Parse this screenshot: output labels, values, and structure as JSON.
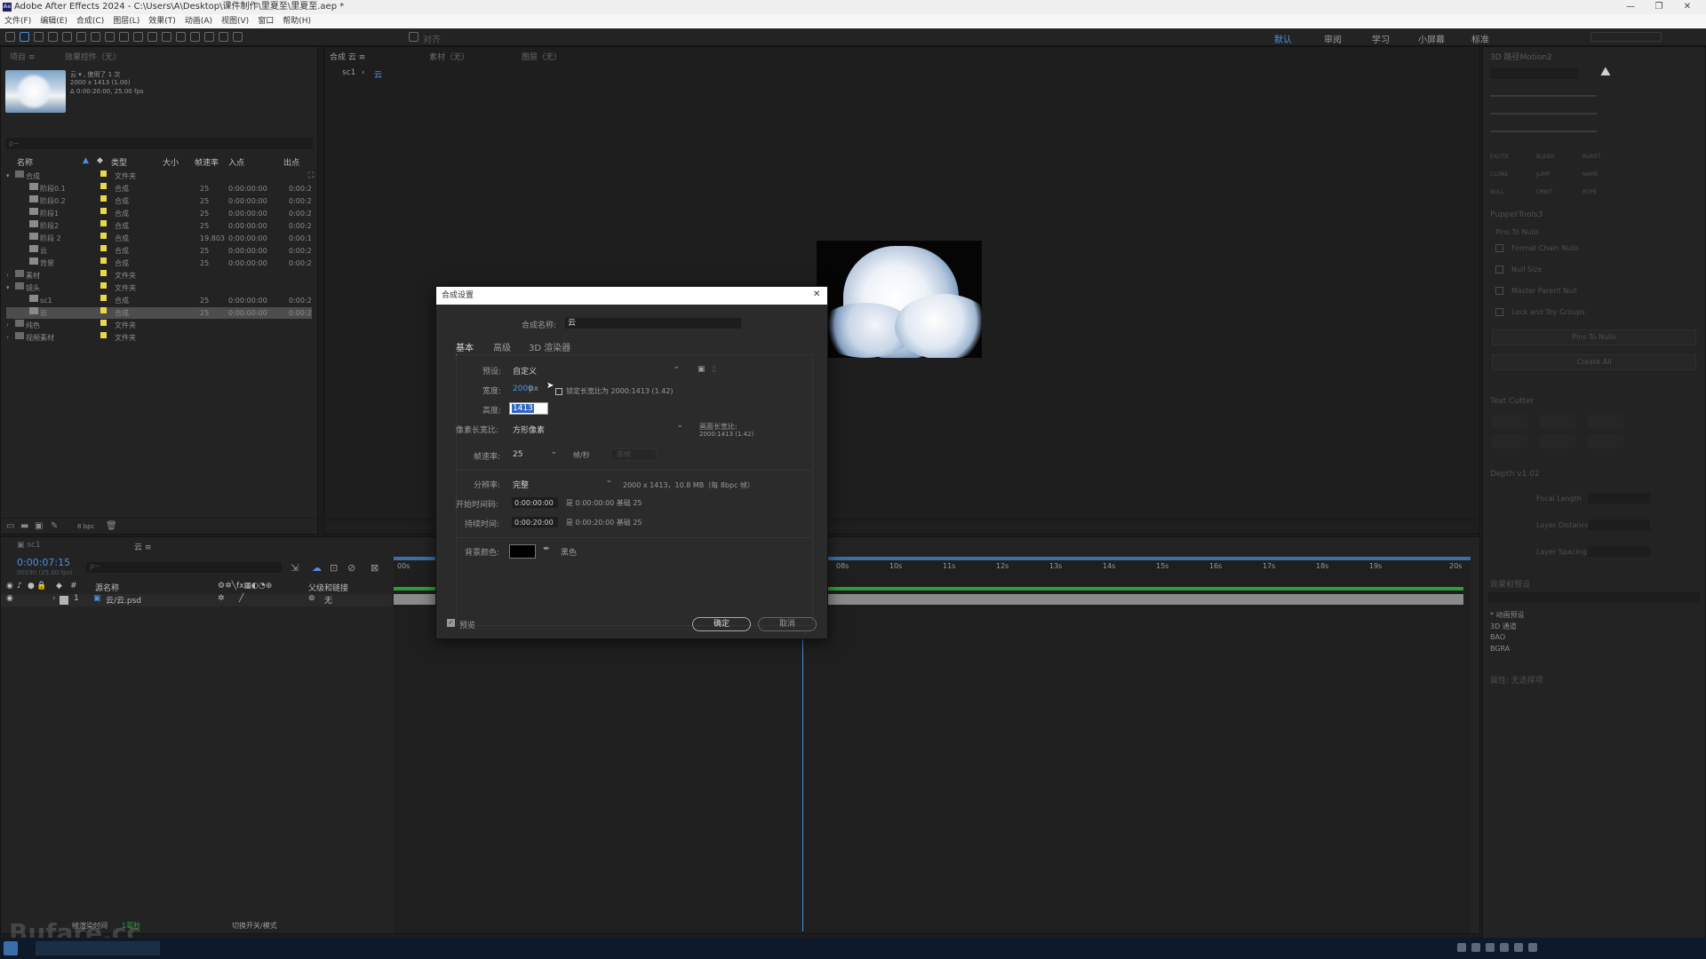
{
  "window": {
    "title": "Adobe After Effects 2024 - C:\\Users\\A\\Desktop\\课件制作\\里夏至\\里夏至.aep *",
    "logo_text": "Ae",
    "minimize": "—",
    "maximize": "❐",
    "close": "✕"
  },
  "menu": [
    "文件(F)",
    "编辑(E)",
    "合成(C)",
    "图层(L)",
    "效果(T)",
    "动画(A)",
    "视图(V)",
    "窗口",
    "帮助(H)"
  ],
  "toolbar": {
    "workspaces": [
      "默认",
      "审阅",
      "学习",
      "小屏幕",
      "标准"
    ],
    "active_workspace": "默认",
    "snap_label": "对齐"
  },
  "project": {
    "tab_project": "项目 ≡",
    "tab_effects": "效果控件（无）",
    "item_name": "云 ▾ , 使用了 1 次",
    "item_dims": "2000 x 1413 (1.00)",
    "item_duration": "Δ 0:00:20:00, 25.00 fps",
    "search_placeholder": "ρ~",
    "columns": {
      "name": "名称",
      "type": "类型",
      "size": "大小",
      "fps": "帧速率",
      "in": "入点",
      "out": "出点"
    },
    "rows": [
      {
        "name": "合成",
        "type": "文件夹",
        "fps": "",
        "in": "",
        "out": "",
        "kind": "folder",
        "indent": 0,
        "open": true,
        "color": "#e8d84a"
      },
      {
        "name": "阶段0.1",
        "type": "合成",
        "fps": "25",
        "in": "0:00:00:00",
        "out": "0:00:2",
        "kind": "comp",
        "indent": 1,
        "color": "#e8d84a"
      },
      {
        "name": "阶段0.2",
        "type": "合成",
        "fps": "25",
        "in": "0:00:00:00",
        "out": "0:00:2",
        "kind": "comp",
        "indent": 1,
        "color": "#e8d84a"
      },
      {
        "name": "阶段1",
        "type": "合成",
        "fps": "25",
        "in": "0:00:00:00",
        "out": "0:00:2",
        "kind": "comp",
        "indent": 1,
        "color": "#e8d84a"
      },
      {
        "name": "阶段2",
        "type": "合成",
        "fps": "25",
        "in": "0:00:00:00",
        "out": "0:00:2",
        "kind": "comp",
        "indent": 1,
        "color": "#e8d84a"
      },
      {
        "name": "阶段 2",
        "type": "合成",
        "fps": "19.803",
        "in": "0:00:00:00",
        "out": "0:00:1",
        "kind": "comp",
        "indent": 1,
        "color": "#e8d84a"
      },
      {
        "name": "云",
        "type": "合成",
        "fps": "25",
        "in": "0:00:00:00",
        "out": "0:00:2",
        "kind": "comp",
        "indent": 1,
        "color": "#e8d84a"
      },
      {
        "name": "背景",
        "type": "合成",
        "fps": "25",
        "in": "0:00:00:00",
        "out": "0:00:2",
        "kind": "comp",
        "indent": 1,
        "color": "#e8d84a"
      },
      {
        "name": "素材",
        "type": "文件夹",
        "fps": "",
        "in": "",
        "out": "",
        "kind": "folder",
        "indent": 0,
        "open": false,
        "color": "#e8d84a"
      },
      {
        "name": "镜头",
        "type": "文件夹",
        "fps": "",
        "in": "",
        "out": "",
        "kind": "folder",
        "indent": 0,
        "open": true,
        "color": "#e8d84a"
      },
      {
        "name": "sc1",
        "type": "合成",
        "fps": "25",
        "in": "0:00:00:00",
        "out": "0:00:2",
        "kind": "comp",
        "indent": 1,
        "color": "#e8d84a"
      },
      {
        "name": "云",
        "type": "合成",
        "fps": "25",
        "in": "0:00:00:00",
        "out": "0:00:2",
        "kind": "comp",
        "indent": 1,
        "color": "#e8d84a",
        "selected": true
      },
      {
        "name": "纯色",
        "type": "文件夹",
        "fps": "",
        "in": "",
        "out": "",
        "kind": "folder",
        "indent": 0,
        "open": false,
        "color": "#e8d84a"
      },
      {
        "name": "视频素材",
        "type": "文件夹",
        "fps": "",
        "in": "",
        "out": "",
        "kind": "folder",
        "indent": 0,
        "open": false,
        "color": "#e8d84a"
      }
    ],
    "bpc": "8 bpc"
  },
  "viewer": {
    "tab_comp": "合成 云 ≡",
    "tab_layer": "图层（无）",
    "tab_footage": "素材（无）",
    "breadcrumb_a": "sc1",
    "breadcrumb_b": "云"
  },
  "dialog": {
    "title": "合成设置",
    "name_label": "合成名称:",
    "name_value": "云",
    "tabs": [
      "基本",
      "高级",
      "3D 渲染器"
    ],
    "preset_label": "预设:",
    "preset_value": "自定义",
    "width_label": "宽度:",
    "width_value": "2000",
    "width_unit": "px",
    "height_label": "高度:",
    "height_value": "1413",
    "lock_label": "锁定长宽比为 2000:1413 (1.42)",
    "par_label": "像素长宽比:",
    "par_value": "方形像素",
    "frame_aspect_label": "画面长宽比:",
    "frame_aspect_value": "2000:1413 (1.42)",
    "fps_label": "帧速率:",
    "fps_value": "25",
    "fps_unit": "帧/秒",
    "drop_frame": "丢帧",
    "res_label": "分辨率:",
    "res_value": "完整",
    "res_info": "2000 x 1413，10.8 MB（每 8bpc 帧）",
    "start_label": "开始时间码:",
    "start_value": "0:00:00:00",
    "start_info": "是 0:00:00:00  基础 25",
    "dur_label": "持续时间:",
    "dur_value": "0:00:20:00",
    "dur_info": "是 0:00:20:00  基础 25",
    "bg_label": "背景颜色:",
    "bg_name": "黑色",
    "preview_label": "预览",
    "ok": "确定",
    "cancel": "取消"
  },
  "timeline": {
    "tab": "云 ≡",
    "timecode": "0:00:07:15",
    "timecode_sub": "00190 (25.00 fps)",
    "search_placeholder": "ρ~",
    "col_source": "源名称",
    "col_parent": "父级和链接",
    "layer_index": "1",
    "layer_name": "云/云.psd",
    "layer_parent": "无",
    "ruler": [
      "00s",
      "08s",
      "10s",
      "11s",
      "12s",
      "13s",
      "14s",
      "15s",
      "16s",
      "17s",
      "18s",
      "19s",
      "20s"
    ],
    "footer_render": "帧渲染时间",
    "footer_ms": "1毫秒",
    "footer_toggle": "切换开关/模式"
  },
  "right": {
    "panel1_title": "3D 路径Motion2",
    "motion_buttons": [
      "EXCITE",
      "BLEND",
      "BURST",
      "CLONE",
      "JUMP",
      "NAME",
      "NULL",
      "ORBIT",
      "ROPE"
    ],
    "panel2_title": "PuppetTools3",
    "panel2_head": "Pins To Nulls",
    "puppet_rows": [
      "Format Chain Nulls",
      "Null Size",
      "Master Parent Null",
      "Lock and Toy Groups"
    ],
    "puppet_btn1": "Pins To Nulls",
    "puppet_btn2": "Create All",
    "panel3_title": "Text Cutter",
    "panel4_title": "Depth v1.02",
    "depth_rows": [
      "Focal Length",
      "Layer Distance",
      "Layer Spacing"
    ],
    "panel5_title": "效果和预设",
    "effects_rows": [
      "* 动画预设",
      "3D 通道",
      "BAO",
      "BGRA"
    ],
    "panel6_title": "属性: 无选择项"
  },
  "watermark": "Bufare.cc"
}
